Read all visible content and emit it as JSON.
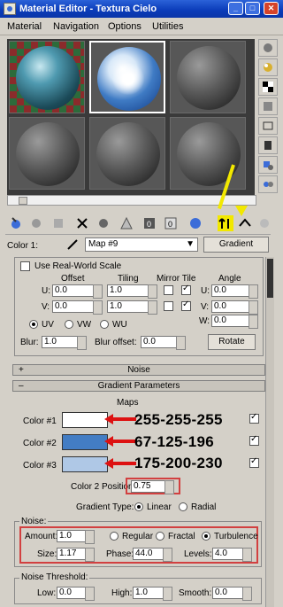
{
  "window": {
    "title": "Material Editor - Textura Cielo"
  },
  "menu": [
    "Material",
    "Navigation",
    "Options",
    "Utilities"
  ],
  "toolbar_row": {
    "color_label": "Color 1:",
    "map_name": "Map #9",
    "map_type_button": "Gradient"
  },
  "coordinates": {
    "real_world_label": "Use Real-World Scale",
    "offset_header": "Offset",
    "tiling_header": "Tiling",
    "mirror_tile_header": "Mirror Tile",
    "angle_header": "Angle",
    "u_label": "U:",
    "v_label": "V:",
    "w_label": "W:",
    "u_offset": "0.0",
    "v_offset": "0.0",
    "u_tiling": "1.0",
    "v_tiling": "1.0",
    "u_angle": "0.0",
    "v_angle": "0.0",
    "w_angle": "0.0",
    "mapping_options": [
      "UV",
      "VW",
      "WU"
    ],
    "blur_label": "Blur:",
    "blur_value": "1.0",
    "blur_offset_label": "Blur offset:",
    "blur_offset_value": "0.0",
    "rotate_button": "Rotate"
  },
  "rollouts": {
    "noise": "Noise",
    "gradient_params": "Gradient Parameters"
  },
  "gradient": {
    "maps_header": "Maps",
    "colors": [
      {
        "label": "Color #1",
        "hex": "#ffffff",
        "annotation": "255-255-255"
      },
      {
        "label": "Color #2",
        "hex": "#437dc4",
        "annotation": "67-125-196"
      },
      {
        "label": "Color #3",
        "hex": "#afc8e6",
        "annotation": "175-200-230"
      }
    ],
    "color2_position_label": "Color 2 Position:",
    "color2_position_value": "0.75",
    "gradient_type_label": "Gradient Type:",
    "gradient_types": [
      "Linear",
      "Radial"
    ]
  },
  "noise": {
    "group_label": "Noise:",
    "amount_label": "Amount:",
    "amount_value": "1.0",
    "types": [
      "Regular",
      "Fractal",
      "Turbulence"
    ],
    "size_label": "Size:",
    "size_value": "1.17",
    "phase_label": "Phase:",
    "phase_value": "44.0",
    "levels_label": "Levels:",
    "levels_value": "4.0"
  },
  "noise_threshold": {
    "group_label": "Noise Threshold:",
    "low_label": "Low:",
    "low_value": "0.0",
    "high_label": "High:",
    "high_value": "1.0",
    "smooth_label": "Smooth:",
    "smooth_value": "0.0"
  },
  "colors": {
    "titlebar": "#0a3bb8",
    "highlight": "#d24040",
    "arrow": "#f2e800"
  }
}
